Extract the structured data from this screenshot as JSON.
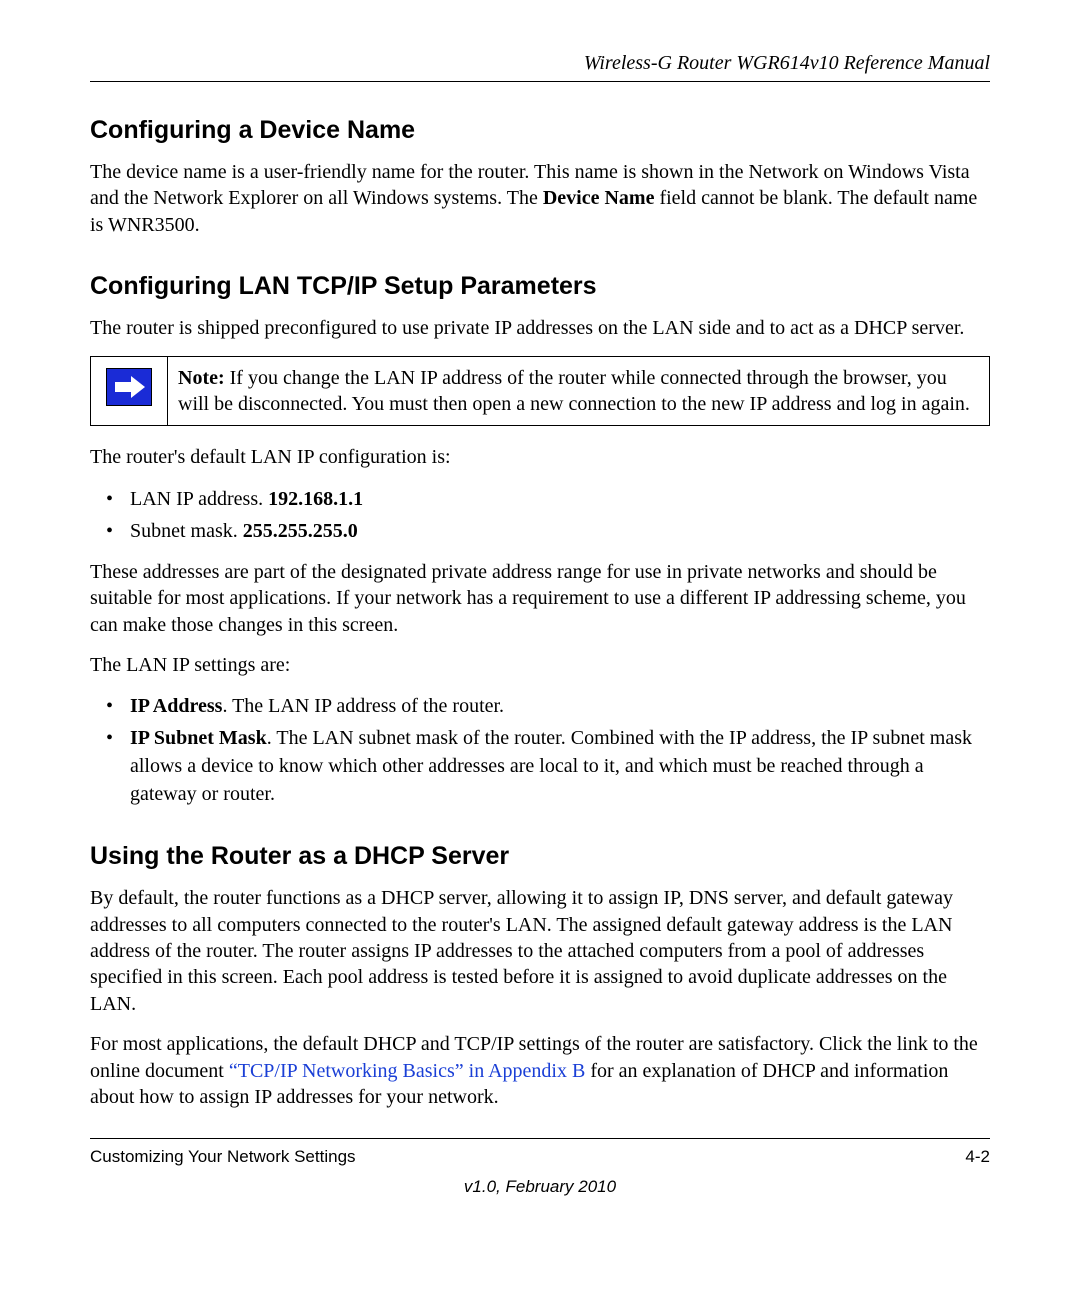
{
  "header": {
    "doc_title": "Wireless-G Router WGR614v10 Reference Manual"
  },
  "sections": {
    "s1": {
      "heading": "Configuring a Device Name",
      "p1a": "The device name is a user-friendly name for the router. This name is shown in the Network on Windows Vista and the Network Explorer on all Windows systems. The ",
      "p1b_bold": "Device Name",
      "p1c": " field cannot be blank. The default name is WNR3500."
    },
    "s2": {
      "heading": "Configuring LAN TCP/IP Setup Parameters",
      "p1": "The router is shipped preconfigured to use private IP addresses on the LAN side and to act as a DHCP server.",
      "note_label": "Note:",
      "note_body": " If you change the LAN IP address of the router while connected through the browser, you will be disconnected. You must then open a new connection to the new IP address and log in again.",
      "p2": "The router's default LAN IP configuration is:",
      "li1_label": "LAN IP address. ",
      "li1_value": "192.168.1.1",
      "li2_label": "Subnet mask. ",
      "li2_value": "255.255.255.0",
      "p3": "These addresses are part of the designated private address range for use in private networks and should be suitable for most applications. If your network has a requirement to use a different IP addressing scheme, you can make those changes in this screen.",
      "p4": "The LAN IP settings are:",
      "li3_bold": "IP Address",
      "li3_rest": ". The LAN IP address of the router.",
      "li4_bold": "IP Subnet Mask",
      "li4_rest": ". The LAN subnet mask of the router. Combined with the IP address, the IP subnet mask allows a device to know which other addresses are local to it, and which must be reached through a gateway or router."
    },
    "s3": {
      "heading": "Using the Router as a DHCP Server",
      "p1": "By default, the router functions as a DHCP server, allowing it to assign IP, DNS server, and default gateway addresses to all computers connected to the router's LAN. The assigned default gateway address is the LAN address of the router. The router assigns IP addresses to the attached computers from a pool of addresses specified in this screen. Each pool address is tested before it is assigned to avoid duplicate addresses on the LAN.",
      "p2a": "For most applications, the default DHCP and TCP/IP settings of the router are satisfactory. Click the link to the online document ",
      "p2_link": "“TCP/IP Networking Basics” in Appendix B",
      "p2b": " for an explanation of DHCP and information about how to assign IP addresses for your network."
    }
  },
  "footer": {
    "left": "Customizing Your Network Settings",
    "right": "4-2",
    "version": "v1.0, February 2010"
  }
}
